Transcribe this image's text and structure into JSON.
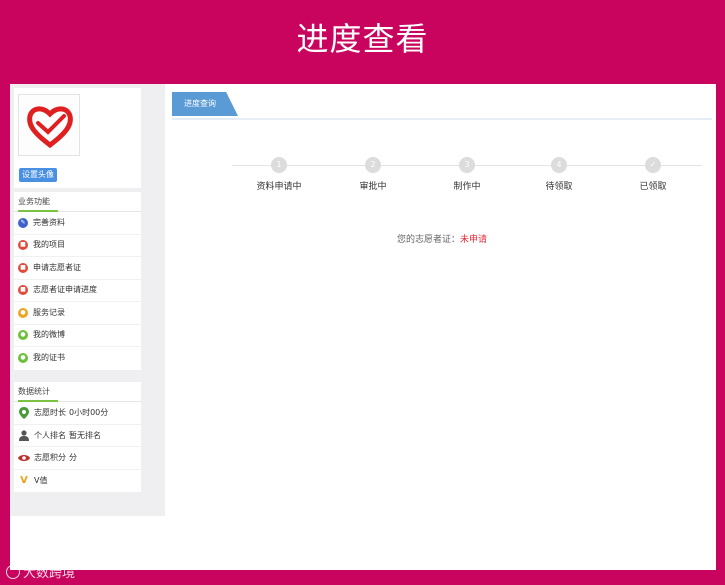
{
  "banner": {
    "title": "进度查看"
  },
  "sidebar": {
    "avatar_button": "设置头像",
    "business": {
      "title": "业务功能",
      "items": [
        {
          "label": "完善资料",
          "icon": "edit-icon",
          "color": "#3d63c9"
        },
        {
          "label": "我的项目",
          "icon": "project-icon",
          "color": "#e04a3a"
        },
        {
          "label": "申请志愿者证",
          "icon": "certificate-apply-icon",
          "color": "#e04a3a"
        },
        {
          "label": "志愿者证申请进度",
          "icon": "progress-icon",
          "color": "#e04a3a"
        },
        {
          "label": "服务记录",
          "icon": "record-icon",
          "color": "#f0a522"
        },
        {
          "label": "我的微博",
          "icon": "weibo-icon",
          "color": "#6cbf3a"
        },
        {
          "label": "我的证书",
          "icon": "certificate-icon",
          "color": "#6cbf3a"
        }
      ]
    },
    "stats": {
      "title": "数据统计",
      "items": [
        {
          "label": "志愿时长",
          "value": "0小时00分",
          "icon": "location-pin-icon"
        },
        {
          "label": "个人排名",
          "value": "暂无排名",
          "icon": "person-icon"
        },
        {
          "label": "志愿积分",
          "value": "分",
          "icon": "eye-icon"
        },
        {
          "label": "V值",
          "value": "",
          "icon": "v-icon"
        }
      ]
    }
  },
  "main": {
    "tab": "进度查询",
    "steps": [
      {
        "num": "1",
        "label": "资料申请中"
      },
      {
        "num": "2",
        "label": "审批中"
      },
      {
        "num": "3",
        "label": "制作中"
      },
      {
        "num": "4",
        "label": "待领取"
      },
      {
        "num": "✓",
        "label": "已领取"
      }
    ],
    "status": {
      "label": "您的志愿者证：",
      "value": "未申请"
    }
  },
  "watermark": "大数跨境",
  "colors": {
    "brand": "#c8045e",
    "accent": "#5b9bd5",
    "status_value": "#e52b3a"
  }
}
